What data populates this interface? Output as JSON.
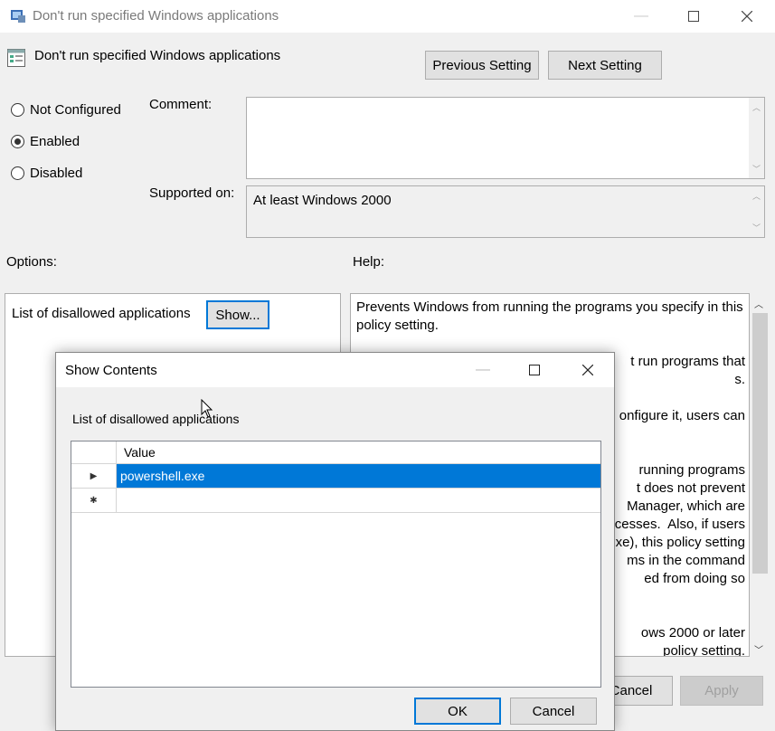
{
  "window": {
    "title": "Don't run specified Windows applications",
    "heading": "Don't run specified Windows applications",
    "prev_button": "Previous Setting",
    "next_button": "Next Setting",
    "radios": [
      {
        "label": "Not Configured",
        "checked": false
      },
      {
        "label": "Enabled",
        "checked": true
      },
      {
        "label": "Disabled",
        "checked": false
      }
    ],
    "comment_label": "Comment:",
    "comment_value": "",
    "supported_label": "Supported on:",
    "supported_value": "At least Windows 2000",
    "options_label": "Options:",
    "help_label": "Help:",
    "option_item_label": "List of disallowed applications",
    "show_button": "Show...",
    "help_text_lines": [
      "Prevents Windows from running the programs you specify in this",
      "policy setting.",
      "",
      "t run programs that",
      "s.",
      "",
      "onfigure it, users can",
      "",
      "",
      "running programs",
      "t does not prevent",
      "Manager, which are",
      "ocesses.  Also, if users",
      "xe), this policy setting",
      "ms in the command",
      "ed from doing so",
      "",
      "",
      "ows 2000 or later",
      " policy setting."
    ],
    "cancel_button": "Cancel",
    "apply_button": "Apply"
  },
  "dialog": {
    "title": "Show Contents",
    "list_label": "List of disallowed applications",
    "column_header": "Value",
    "rows": [
      {
        "marker": "▶",
        "value": "powershell.exe",
        "selected": true
      },
      {
        "marker": "✱",
        "value": "",
        "selected": false
      }
    ],
    "ok_button": "OK",
    "cancel_button": "Cancel"
  }
}
